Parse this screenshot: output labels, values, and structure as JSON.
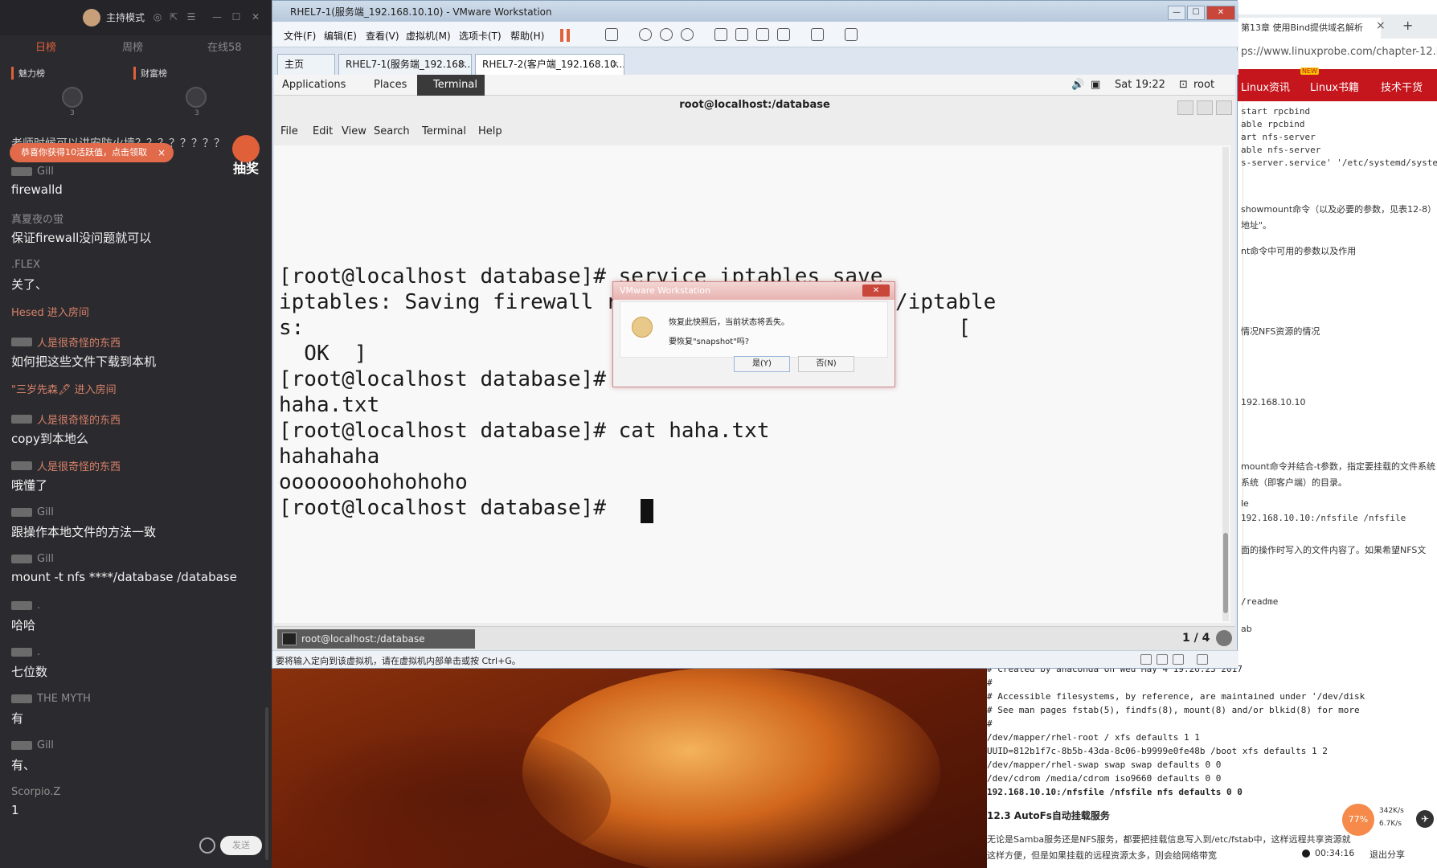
{
  "chat": {
    "mode_label": "主持模式",
    "tabs": [
      "日榜",
      "周榜",
      "在线58"
    ],
    "rank_tabs": [
      "魅力榜",
      "财富榜"
    ],
    "rank_numbers": [
      "3",
      "3"
    ],
    "previous_message": "老师时候可以讲安防火墙？？？？？？？？",
    "gift_banner": "恭喜你获得10活跃值，点击领取",
    "gift_close": "×",
    "lottery_label": "抽奖",
    "messages": [
      {
        "name": "Gill",
        "text": "firewalld",
        "badge": true
      },
      {
        "name": "真夏夜の蛍",
        "text": "保证firewall没问题就可以",
        "badge": false
      },
      {
        "name": ".FLEX",
        "text": "关了、",
        "badge": false
      },
      {
        "name": "Hesed 进入房间",
        "text": "",
        "badge": false,
        "enter": true
      },
      {
        "name": "人是很奇怪的东西",
        "text": "如何把这些文件下载到本机",
        "badge": true,
        "orange": true
      },
      {
        "name": "\"三岁先森🖋 进入房间",
        "text": "",
        "badge": false,
        "enter": true
      },
      {
        "name": "人是很奇怪的东西",
        "text": "copy到本地么",
        "badge": true,
        "orange": true
      },
      {
        "name": "人是很奇怪的东西",
        "text": "哦懂了",
        "badge": true,
        "orange": true
      },
      {
        "name": "Gill",
        "text": "跟操作本地文件的方法一致",
        "badge": true
      },
      {
        "name": "Gill",
        "text": "mount -t nfs ****/database /database",
        "badge": true
      },
      {
        "name": ".",
        "text": "哈哈",
        "badge": true
      },
      {
        "name": ".",
        "text": "七位数",
        "badge": true
      },
      {
        "name": "THE MYTH",
        "text": "有",
        "badge": true
      },
      {
        "name": "Gill",
        "text": "有、",
        "badge": true
      },
      {
        "name": "Scorpio.Z",
        "text": "1",
        "badge": false
      }
    ],
    "send_label": "发送"
  },
  "vmware": {
    "title": "RHEL7-1(服务端_192.168.10.10) - VMware Workstation",
    "menus": [
      "文件(F)",
      "编辑(E)",
      "查看(V)",
      "虚拟机(M)",
      "选项卡(T)",
      "帮助(H)"
    ],
    "tabs": [
      {
        "label": "主页",
        "active": false
      },
      {
        "label": "RHEL7-1(服务端_192.168....",
        "active": false
      },
      {
        "label": "RHEL7-2(客户端_192.168.10...",
        "active": true
      }
    ],
    "status_text": "要将输入定向到该虚拟机，请在虚拟机内部单击或按 Ctrl+G。"
  },
  "guest": {
    "topbar": {
      "applications": "Applications",
      "places": "Places",
      "terminal": "Terminal",
      "clock": "Sat 19:22",
      "user": "root"
    },
    "terminal_title": "root@localhost:/database",
    "terminal_menu": [
      "File",
      "Edit",
      "View",
      "Search",
      "Terminal",
      "Help"
    ],
    "terminal_lines": [
      "[root@localhost database]# service iptables save",
      "iptables: Saving firewall rules to /etc/sysconfig/iptable",
      "s:                                                    [",
      "  OK  ]",
      "[root@localhost database]# ls",
      "haha.txt",
      "[root@localhost database]# cat haha.txt",
      "hahahaha",
      "ooooooohohohoho",
      "[root@localhost database]# "
    ],
    "taskbar_item": "root@localhost:/database",
    "pager": "1 / 4"
  },
  "dialog": {
    "title": "VMware Workstation",
    "message_line1": "恢复此快照后，当前状态将丢失。",
    "message_line2": "要恢复\"snapshot\"吗?",
    "yes_label": "是(Y)",
    "no_label": "否(N)"
  },
  "browser": {
    "tab_title": "第13章 使用Bind提供域名解析",
    "tab_close": "×",
    "new_tab": "+",
    "url": "ps://www.linuxprobe.com/chapter-12.h",
    "nav": [
      "Linux资讯",
      "Linux书籍",
      "技术干货"
    ],
    "new_badge": "NEW",
    "side_lines": [
      "start rpcbind",
      "able rpcbind",
      "art nfs-server",
      "able nfs-server",
      "s-server.service' '/etc/systemd/syster",
      "showmount命令（以及必要的参数，见表12-8）",
      "地址\"。",
      "nt命令中可用的参数以及作用",
      "情况NFS资源的情况",
      "192.168.10.10",
      "mount命令并结合-t参数，指定要挂载的文件系统",
      "系统（即客户端）的目录。",
      "le",
      "192.168.10.10:/nfsfile /nfsfile",
      "面的操作时写入的文件内容了。如果希望NFS文",
      "/readme",
      "ab"
    ],
    "fstab_lines": [
      "# Created by anaconda on Wed May  4 19:26:23 2017",
      "#",
      "# Accessible filesystems, by reference, are maintained under '/dev/disk",
      "# See man pages fstab(5), findfs(8), mount(8) and/or blkid(8) for more",
      "#",
      "/dev/mapper/rhel-root / xfs defaults 1 1",
      "UUID=812b1f7c-8b5b-43da-8c06-b9999e0fe48b /boot xfs defaults 1 2",
      "/dev/mapper/rhel-swap swap swap defaults 0 0",
      "/dev/cdrom /media/cdrom iso9660 defaults 0 0",
      "192.168.10.10:/nfsfile /nfsfile nfs defaults 0 0"
    ],
    "heading": "12.3 AutoFs自动挂载服务",
    "para1": "无论是Samba服务还是NFS服务，都要把挂载信息写入到/etc/fstab中，这样远程共享资源就",
    "para2": "这样方便，但是如果挂载的远程资源太多，则会给网络带宽"
  },
  "recorder": {
    "percent": "77%",
    "up_speed": "342K/s",
    "down_speed": "6.7K/s",
    "elapsed": "00:34:16",
    "exit_label": "退出分享"
  }
}
